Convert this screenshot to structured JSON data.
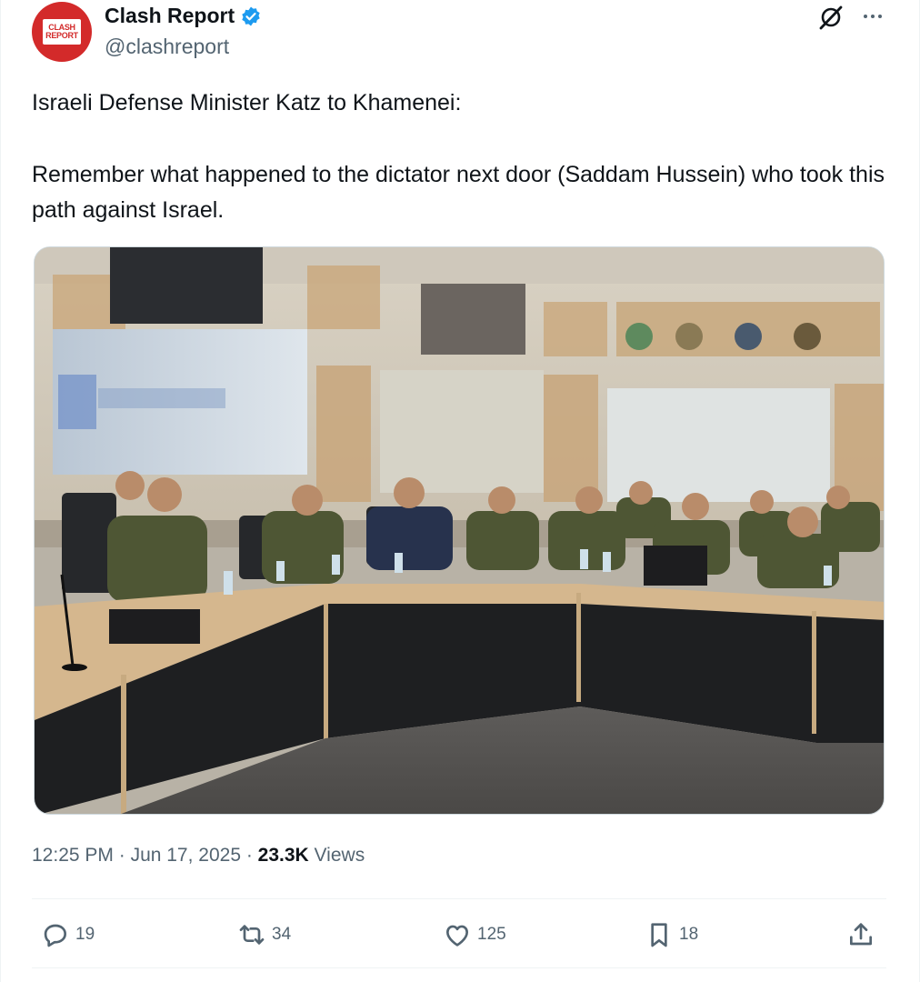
{
  "author": {
    "display_name": "Clash Report",
    "handle": "@clashreport",
    "avatar_text": [
      "CLASH",
      "REPORT"
    ],
    "avatar_icon": "clash-report-logo",
    "verified_icon": "verified-badge-icon",
    "accent_color": "#1d9bf0"
  },
  "header_icons": {
    "grok": "grok-icon",
    "more": "more-icon"
  },
  "tweet": {
    "line1": "Israeli Defense Minister Katz to Khamenei:",
    "line2": "Remember what happened to the dictator next door (Saddam Hussein) who took this path against Israel."
  },
  "media": {
    "icon": "photo"
  },
  "meta": {
    "time": "12:25 PM",
    "sep1": " · ",
    "date": "Jun 17, 2025",
    "sep2": " · ",
    "views_count": "23.3K",
    "views_label": " Views"
  },
  "actions": {
    "reply": {
      "icon": "reply-icon",
      "count": "19"
    },
    "repost": {
      "icon": "repost-icon",
      "count": "34"
    },
    "like": {
      "icon": "heart-icon",
      "count": "125"
    },
    "bookmark": {
      "icon": "bookmark-icon",
      "count": "18"
    },
    "share": {
      "icon": "share-icon"
    }
  },
  "colors": {
    "text": "#0f1419",
    "secondary": "#536471",
    "brand_red": "#d32a2a",
    "verified": "#1d9bf0"
  }
}
